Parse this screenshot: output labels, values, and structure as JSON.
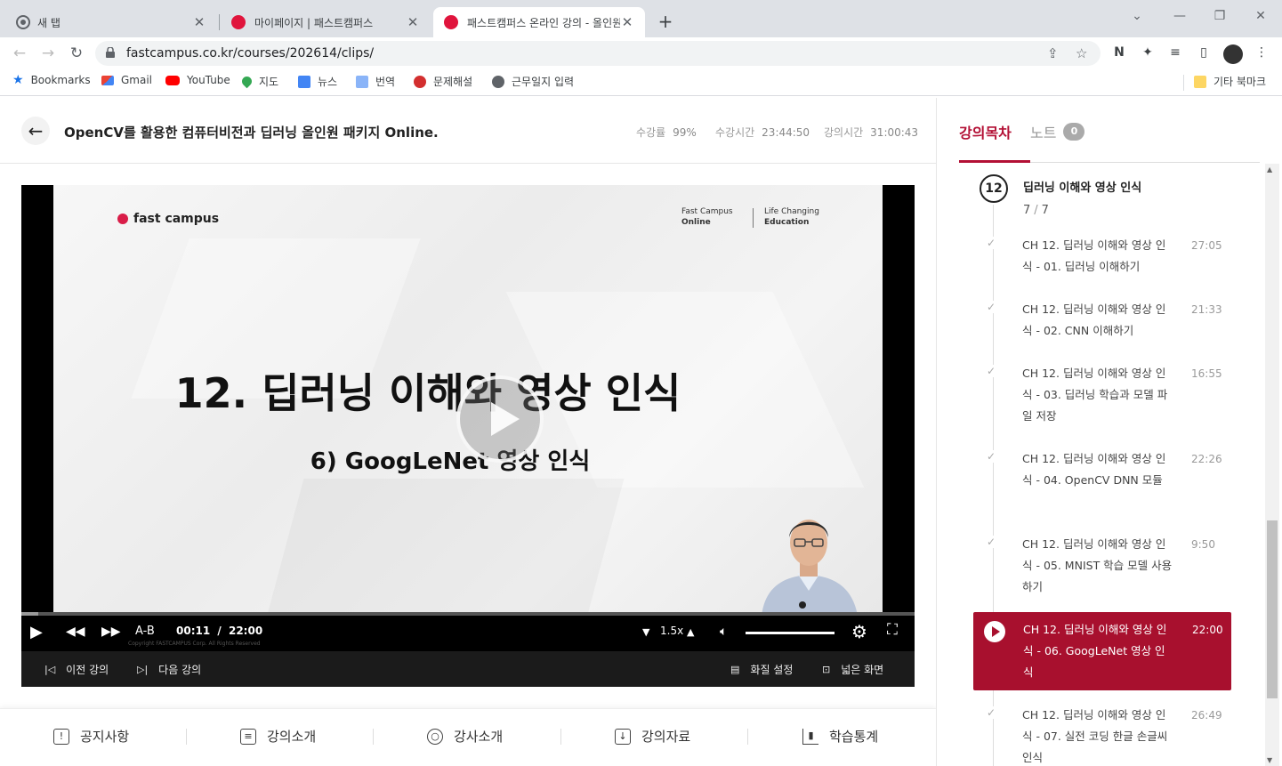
{
  "browser": {
    "tabs": [
      {
        "title": "새 탭",
        "icon": "chrome-icon"
      },
      {
        "title": "마이페이지 | 패스트캠퍼스",
        "icon": "fastcampus-icon"
      },
      {
        "title": "패스트캠퍼스 온라인 강의 - 올인원",
        "icon": "fastcampus-icon"
      }
    ],
    "url": "fastcampus.co.kr/courses/202614/clips/"
  },
  "bookmarks": [
    {
      "label": "Bookmarks",
      "icon": "star-icon"
    },
    {
      "label": "Gmail",
      "icon": "gmail-icon"
    },
    {
      "label": "YouTube",
      "icon": "youtube-icon"
    },
    {
      "label": "지도",
      "icon": "maps-icon"
    },
    {
      "label": "뉴스",
      "icon": "news-icon"
    },
    {
      "label": "번역",
      "icon": "translate-icon"
    },
    {
      "label": "문제해설",
      "icon": "bookmark-icon"
    },
    {
      "label": "근무일지 입력",
      "icon": "globe-icon"
    },
    {
      "label": "기타 북마크",
      "icon": "folder-icon"
    }
  ],
  "course": {
    "title": "OpenCV를 활용한 컴퓨터비전과 딥러닝 올인원 패키지 Online.",
    "stats": [
      {
        "label": "수강률",
        "value": "99%"
      },
      {
        "label": "수강시간",
        "value": "23:44:50"
      },
      {
        "label": "강의시간",
        "value": "31:00:43"
      }
    ]
  },
  "video": {
    "logo": "fast campus",
    "tag_left": [
      "Fast Campus",
      "Online"
    ],
    "tag_right": [
      "Life Changing",
      "Education"
    ],
    "slide_title": "12. 딥러닝 이해와 영상 인식",
    "slide_subtitle": "6) GoogLeNet 영상 인식",
    "copyright": "Copyright FASTCAMPUS Corp. All Rights Reserved",
    "current_time": "00:11",
    "time_sep": "/",
    "duration": "22:00",
    "progress": 0.0083,
    "ab_label": "A-B",
    "speed": "1.5x",
    "prev_label": "이전 강의",
    "next_label": "다음 강의",
    "quality_label": "화질 설정",
    "wide_label": "넓은 화면"
  },
  "bottom_tabs": [
    {
      "label": "공지사항",
      "icon": "notice-icon"
    },
    {
      "label": "강의소개",
      "icon": "clipboard-icon"
    },
    {
      "label": "강사소개",
      "icon": "user-icon"
    },
    {
      "label": "강의자료",
      "icon": "download-icon"
    },
    {
      "label": "학습통계",
      "icon": "chart-icon"
    }
  ],
  "sidebar": {
    "tab_toc": "강의목차",
    "tab_note": "노트",
    "note_count": "0",
    "chapter_num": "12",
    "chapter_title": "딥러닝 이해와 영상 인식",
    "chapter_done": "7",
    "chapter_total": "7",
    "lessons": [
      {
        "title": "CH 12. 딥러닝 이해와 영상 인식 - 01. 딥러닝 이해하기",
        "duration": "27:05"
      },
      {
        "title": "CH 12. 딥러닝 이해와 영상 인식 - 02. CNN 이해하기",
        "duration": "21:33"
      },
      {
        "title": "CH 12. 딥러닝 이해와 영상 인식 - 03. 딥러닝 학습과 모델 파일 저장",
        "duration": "16:55"
      },
      {
        "title": "CH 12. 딥러닝 이해와 영상 인식 - 04. OpenCV DNN 모듈",
        "duration": "22:26"
      },
      {
        "title": "CH 12. 딥러닝 이해와 영상 인식 - 05. MNIST 학습 모델 사용하기",
        "duration": "9:50"
      },
      {
        "title": "CH 12. 딥러닝 이해와 영상 인식 - 06. GoogLeNet 영상 인식",
        "duration": "22:00"
      },
      {
        "title": "CH 12. 딥러닝 이해와 영상 인식 - 07. 실전 코딩 한글 손글씨 인식",
        "duration": "26:49"
      }
    ]
  },
  "colors": {
    "brand": "#a8102e",
    "brand_text": "#b31035",
    "progress": "#d4153c"
  }
}
